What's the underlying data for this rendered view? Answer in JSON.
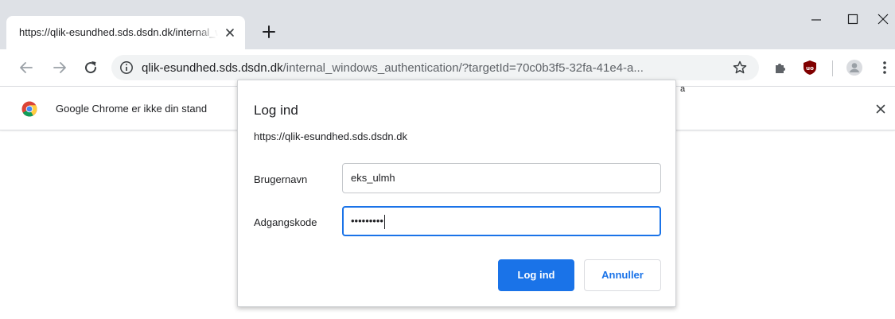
{
  "tab": {
    "title": "https://qlik-esundhed.sds.dsdn.dk/internal_windows_authentication"
  },
  "address_bar": {
    "host": "qlik-esundhed.sds.dsdn.dk",
    "path": "/internal_windows_authentication/?targetId=70c0b3f5-32fa-41e4-a..."
  },
  "infobar": {
    "message": "Google Chrome er ikke din stand"
  },
  "dialog": {
    "title": "Log ind",
    "origin": "https://qlik-esundhed.sds.dsdn.dk",
    "username_label": "Brugernavn",
    "username_value": "eks_ulmh",
    "password_label": "Adgangskode",
    "password_value": "•••••••••",
    "login_button": "Log ind",
    "cancel_button": "Annuller",
    "overlap_text": "a"
  },
  "colors": {
    "accent": "#1a73e8",
    "tabstrip": "#dee1e6",
    "omnibox": "#f1f3f4",
    "ublock": "#800000"
  },
  "icons": [
    "close-icon",
    "plus-icon",
    "minimize-icon",
    "maximize-icon",
    "back-arrow-icon",
    "forward-arrow-icon",
    "reload-icon",
    "info-icon",
    "star-icon",
    "puzzle-icon",
    "ublock-icon",
    "profile-avatar-icon",
    "kebab-menu-icon",
    "chrome-logo-icon"
  ]
}
